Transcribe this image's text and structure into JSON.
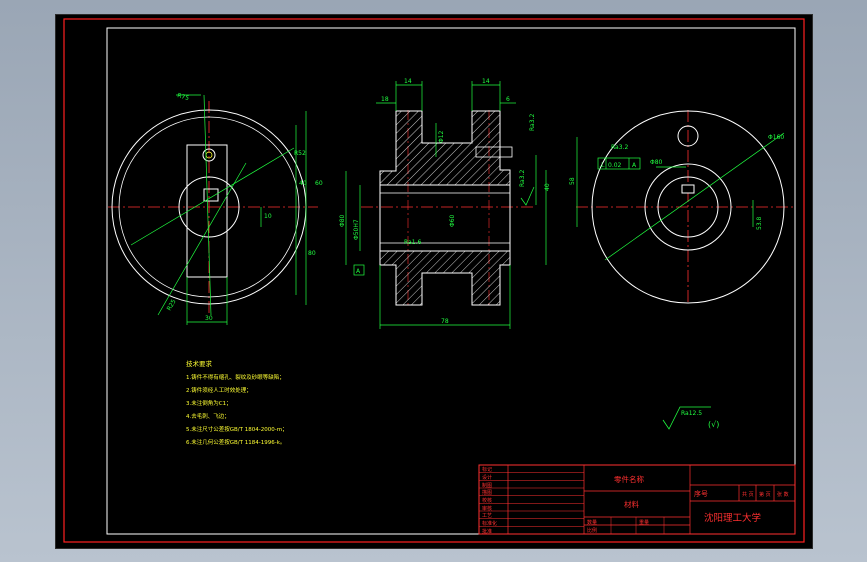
{
  "colors": {
    "border": "#ff2020",
    "outline": "#ffffff",
    "center": "#ff3030",
    "dim": "#20ff40",
    "hatch": "#ffffff",
    "notes": "#ffff33",
    "titleblock": "#ff3030",
    "title_text": "#ffff66"
  },
  "dims": {
    "left_r75": "R75",
    "left_r52": "R52",
    "left_dia_small": "60",
    "left_10": "10",
    "left_h1": "40",
    "left_h2": "80",
    "left_bottom": "30",
    "left_b2": "R25",
    "mid_top1": "14",
    "mid_top2": "14",
    "mid_18": "18",
    "mid_6": "6",
    "mid_d12": "Φ12",
    "mid_ra32": "Ra3.2",
    "mid_ra1": "Ra1.6",
    "mid_d50h7": "Φ50H7",
    "mid_d80": "Φ80",
    "mid_d60": "Φ60",
    "mid_40": "40",
    "mid_bottom": "78",
    "mid_a": "A",
    "mid_right_ra": "Ra3.2",
    "right_ra32": "Ra3.2",
    "right_tol_sym": "⊥",
    "right_tol_val": "0.02",
    "right_tol_ref": "A",
    "right_d160": "Φ160",
    "right_d80": "Φ80",
    "right_58": "58",
    "right_53": "53.8"
  },
  "notes": {
    "title": "技术要求",
    "items": [
      "1.铸件不得有缩孔、裂纹及砂眼等缺陷；",
      "2.铸件须经人工时效处理；",
      "3.未注倒角为C1；",
      "4.去毛刺、飞边；",
      "5.未注尺寸公差按GB/T 1804-2000-m；",
      "6.未注几何公差按GB/T 1184-1996-k。"
    ]
  },
  "roughness": {
    "value": "Ra12.5",
    "suffix": "(√)"
  },
  "titleblock": {
    "part_name": "零件名称",
    "material": "材料",
    "seq": "序号",
    "university": "沈阳理工大学",
    "row_labels": [
      "标记",
      "设计",
      "制图",
      "描图",
      "校核",
      "审核",
      "工艺",
      "标准化",
      "批准"
    ],
    "small_labels": [
      "共 页",
      "第 页",
      "张 数"
    ],
    "bottom_labels": [
      "数量",
      "重量",
      "比例"
    ]
  }
}
